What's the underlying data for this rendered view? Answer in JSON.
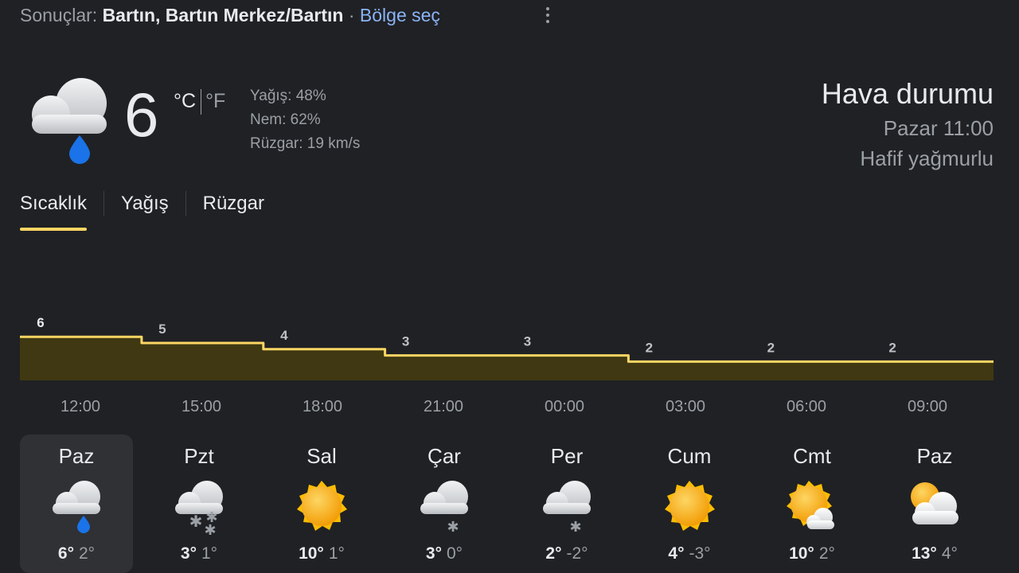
{
  "results": {
    "prefix": "Sonuçlar:",
    "location": "Bartın, Bartın Merkez/Bartın",
    "separator": "·",
    "region_link": "Bölge seç"
  },
  "current": {
    "icon": "rain-icon",
    "temp": "6",
    "unit_c": "°C",
    "unit_f": "°F",
    "precip": "Yağış: 48%",
    "humidity": "Nem: 62%",
    "wind": "Rüzgar: 19 km/s",
    "title": "Hava durumu",
    "time": "Pazar 11:00",
    "condition": "Hafif yağmurlu"
  },
  "tabs": [
    {
      "label": "Sıcaklık",
      "active": true
    },
    {
      "label": "Yağış",
      "active": false
    },
    {
      "label": "Rüzgar",
      "active": false
    }
  ],
  "colors": {
    "background": "#202124",
    "line": "#fdd663",
    "fill": "#3f3812",
    "link": "#8ab4f8",
    "raindrop": "#1a73e8",
    "sun": "#fbbc04"
  },
  "chart_data": {
    "type": "area",
    "x": [
      "12:00",
      "15:00",
      "18:00",
      "21:00",
      "00:00",
      "03:00",
      "06:00",
      "09:00"
    ],
    "values": [
      6,
      5,
      4,
      3,
      3,
      2,
      2,
      2
    ],
    "labels": [
      "6",
      "5",
      "4",
      "3",
      "3",
      "2",
      "2",
      "2"
    ],
    "ylim": [
      0,
      6
    ],
    "grid": false
  },
  "days": [
    {
      "name": "Paz",
      "icon": "rain-icon",
      "hi": "6°",
      "lo": "2°",
      "selected": true
    },
    {
      "name": "Pzt",
      "icon": "snow-icon",
      "hi": "3°",
      "lo": "1°",
      "selected": false
    },
    {
      "name": "Sal",
      "icon": "sun-icon",
      "hi": "10°",
      "lo": "1°",
      "selected": false
    },
    {
      "name": "Çar",
      "icon": "snow-light-icon",
      "hi": "3°",
      "lo": "0°",
      "selected": false
    },
    {
      "name": "Per",
      "icon": "snow-light-icon",
      "hi": "2°",
      "lo": "-2°",
      "selected": false
    },
    {
      "name": "Cum",
      "icon": "sun-icon",
      "hi": "4°",
      "lo": "-3°",
      "selected": false
    },
    {
      "name": "Cmt",
      "icon": "partly-cloudy-icon",
      "hi": "10°",
      "lo": "2°",
      "selected": false
    },
    {
      "name": "Paz",
      "icon": "mostly-cloudy-icon",
      "hi": "13°",
      "lo": "4°",
      "selected": false
    }
  ]
}
